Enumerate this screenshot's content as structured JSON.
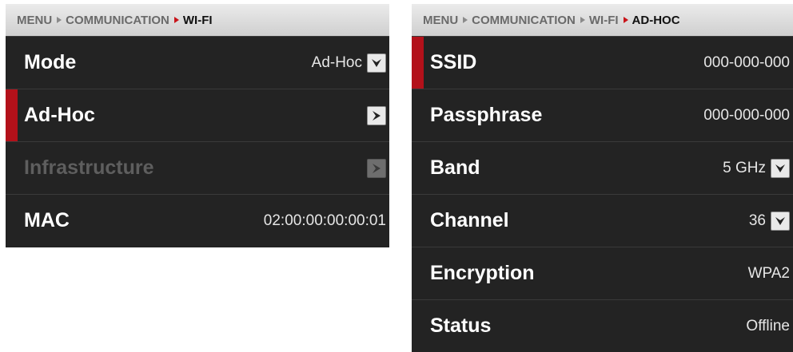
{
  "left_panel": {
    "breadcrumb": [
      "MENU",
      "COMMUNICATION",
      "WI-FI"
    ],
    "rows": [
      {
        "label": "Mode",
        "value": "Ad-Hoc",
        "control": "dropdown"
      },
      {
        "label": "Ad-Hoc",
        "value": "",
        "control": "arrow",
        "selected": true
      },
      {
        "label": "Infrastructure",
        "value": "",
        "control": "arrow",
        "disabled": true
      },
      {
        "label": "MAC",
        "value": "02:00:00:00:00:01",
        "control": "none"
      }
    ]
  },
  "right_panel": {
    "breadcrumb": [
      "MENU",
      "COMMUNICATION",
      "WI-FI",
      "AD-HOC"
    ],
    "rows": [
      {
        "label": "SSID",
        "value": "000-000-000",
        "control": "none",
        "selected": true
      },
      {
        "label": "Passphrase",
        "value": "000-000-000",
        "control": "none"
      },
      {
        "label": "Band",
        "value": "5 GHz",
        "control": "dropdown"
      },
      {
        "label": "Channel",
        "value": "36",
        "control": "dropdown"
      },
      {
        "label": "Encryption",
        "value": "WPA2",
        "control": "none"
      },
      {
        "label": "Status",
        "value": "Offline",
        "control": "none"
      }
    ]
  },
  "colors": {
    "accent": "#b3111a",
    "panel_bg": "#232323",
    "breadcrumb_bg": "#dcdcdc"
  }
}
